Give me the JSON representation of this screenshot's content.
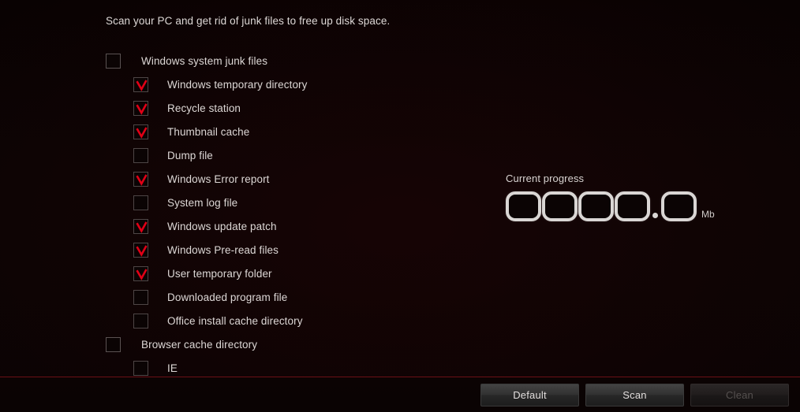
{
  "description": "Scan your PC and get rid of junk files to free up disk space.",
  "colors": {
    "background": "#0a0303",
    "check_red": "#e00016",
    "separator_red": "#6b0f16",
    "text": "#ddd8d6",
    "digit_stroke": "#d9d6d4"
  },
  "list": [
    {
      "label": "Windows system junk files",
      "checked": false,
      "level": "parent"
    },
    {
      "label": "Windows temporary directory",
      "checked": true,
      "level": "child"
    },
    {
      "label": "Recycle station",
      "checked": true,
      "level": "child"
    },
    {
      "label": "Thumbnail cache",
      "checked": true,
      "level": "child"
    },
    {
      "label": "Dump file",
      "checked": false,
      "level": "child"
    },
    {
      "label": "Windows Error report",
      "checked": true,
      "level": "child"
    },
    {
      "label": "System log file",
      "checked": false,
      "level": "child"
    },
    {
      "label": "Windows update patch",
      "checked": true,
      "level": "child"
    },
    {
      "label": "Windows Pre-read files",
      "checked": true,
      "level": "child"
    },
    {
      "label": "User temporary folder",
      "checked": true,
      "level": "child"
    },
    {
      "label": "Downloaded program file",
      "checked": false,
      "level": "child"
    },
    {
      "label": "Office install cache directory",
      "checked": false,
      "level": "child"
    },
    {
      "label": "Browser cache directory",
      "checked": false,
      "level": "parent"
    },
    {
      "label": "IE",
      "checked": false,
      "level": "child"
    }
  ],
  "progress": {
    "title": "Current progress",
    "value": "0000.0",
    "digits": [
      "0",
      "0",
      "0",
      "0",
      "0"
    ],
    "decimal_after_index": 4,
    "unit": "Mb"
  },
  "footer": {
    "buttons": [
      {
        "label": "Default",
        "enabled": true
      },
      {
        "label": "Scan",
        "enabled": true
      },
      {
        "label": "Clean",
        "enabled": false
      }
    ]
  }
}
